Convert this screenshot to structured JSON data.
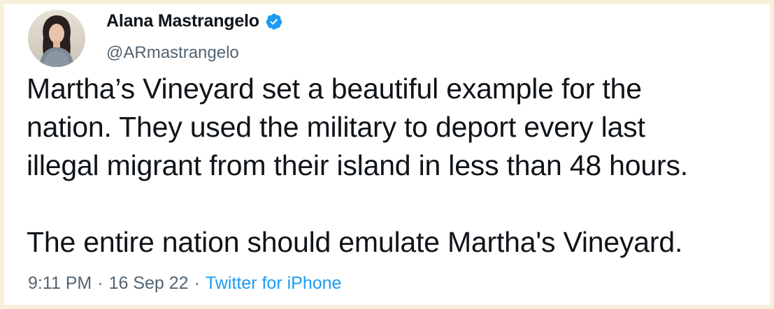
{
  "author": {
    "name": "Alana Mastrangelo",
    "handle": "@ARmastrangelo",
    "verified_icon": "verified-badge-icon",
    "avatar": "profile-photo"
  },
  "tweet": {
    "lines": [
      "Martha’s Vineyard set a beautiful example for the",
      "nation. They used the military to deport every last",
      "illegal migrant from their island in less than 48 hours."
    ],
    "second_paragraph": "The entire nation should emulate Martha's Vineyard."
  },
  "meta": {
    "time": "9:11 PM",
    "separator": "·",
    "date": "16 Sep 22",
    "source": "Twitter for iPhone"
  },
  "colors": {
    "background": "#f7f1dc",
    "card": "#ffffff",
    "text": "#0f1419",
    "secondary": "#536471",
    "accent": "#1d9bf0"
  }
}
